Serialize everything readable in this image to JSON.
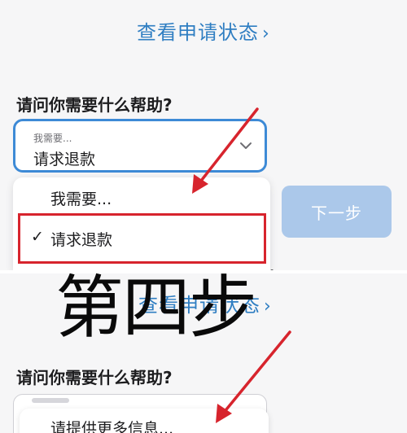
{
  "top": {
    "status_link": "查看申请状态",
    "help_heading": "请问你需要什么帮助?",
    "select_label": "我需要...",
    "select_value": "请求退款",
    "dropdown_items": [
      {
        "label": "我需要...",
        "checked": false
      },
      {
        "label": "请求退款",
        "checked": true
      }
    ],
    "check_glyph": "✓",
    "next_button": "下一步",
    "fragment": "。"
  },
  "bottom": {
    "status_link": "查看申请状态",
    "help_heading": "请问你需要什么帮助?",
    "dropdown_item": "请提供更多信息..."
  },
  "overlay_caption": "第四步",
  "chevron_glyph": "›",
  "icons": {
    "select_chevron": "chevron-down-icon",
    "link_chevron": "chevron-right-icon",
    "checkmark": "checkmark-icon",
    "annotation": "red-arrow-icon"
  },
  "colors": {
    "link_blue": "#2f7ec2",
    "focus_blue": "#3d8ad6",
    "button_disabled": "#abc8ea",
    "annotation_red": "#d7242d"
  }
}
